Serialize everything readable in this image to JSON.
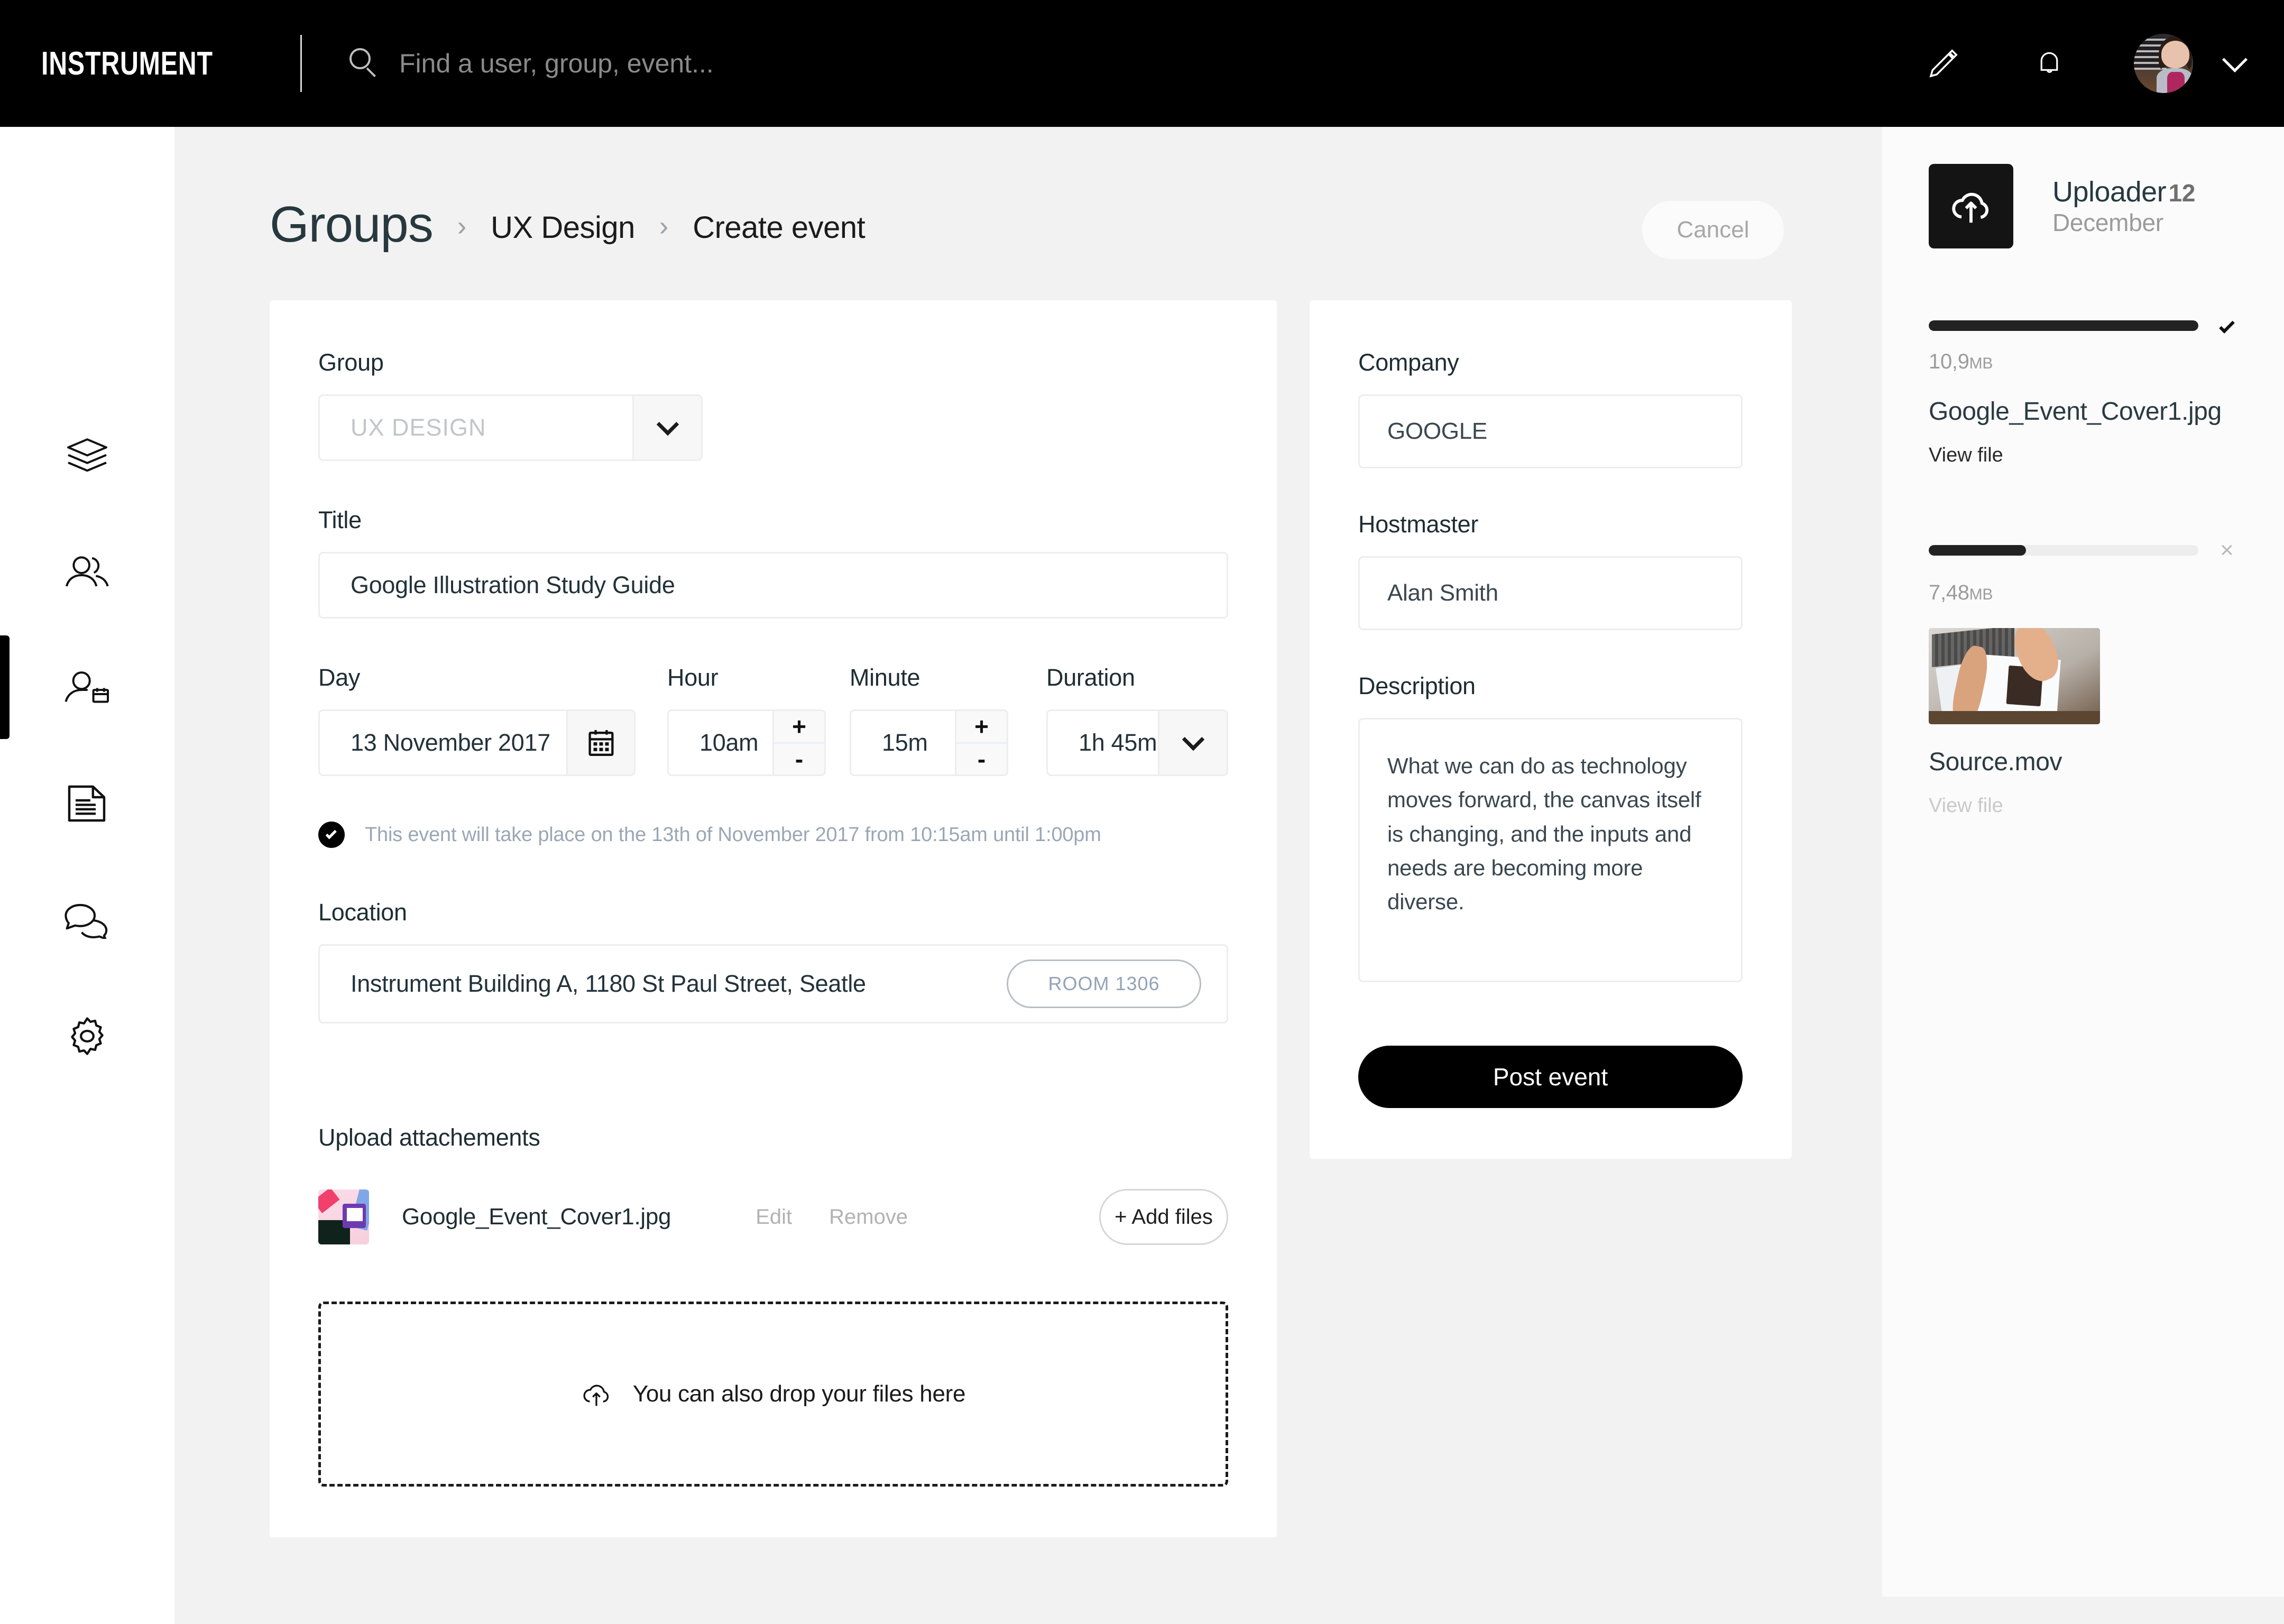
{
  "header": {
    "brand": "INSTRUMENT",
    "search_placeholder": "Find a user, group, event...",
    "icons": {
      "edit": "pencil-icon",
      "notifications": "bell-icon",
      "account": "avatar",
      "chevron": "chevron-down-icon"
    }
  },
  "sidebar": {
    "items": [
      {
        "name": "layers-icon",
        "active": false
      },
      {
        "name": "users-icon",
        "active": false
      },
      {
        "name": "user-calendar-icon",
        "active": true
      },
      {
        "name": "document-icon",
        "active": false
      },
      {
        "name": "chat-icon",
        "active": false
      },
      {
        "name": "settings-gear-icon",
        "active": false
      }
    ]
  },
  "breadcrumb": {
    "root": "Groups",
    "separator": "›",
    "level2": "UX Design",
    "level3": "Create event"
  },
  "actions": {
    "cancel": "Cancel"
  },
  "form": {
    "group": {
      "label": "Group",
      "value": "UX DESIGN"
    },
    "title": {
      "label": "Title",
      "value": "Google Illustration Study Guide"
    },
    "day": {
      "label": "Day",
      "value": "13 November 2017"
    },
    "hour": {
      "label": "Hour",
      "value": "10am",
      "increment": "+",
      "decrement": "-"
    },
    "minute": {
      "label": "Minute",
      "value": "15m",
      "increment": "+",
      "decrement": "-"
    },
    "duration": {
      "label": "Duration",
      "value": "1h 45m"
    },
    "confirmation": "This event will take place on the 13th of November 2017 from 10:15am until 1:00pm",
    "location": {
      "label": "Location",
      "value": "Instrument Building A, 1180 St Paul Street, Seatle",
      "room": "ROOM 1306"
    },
    "upload": {
      "label": "Upload attachements",
      "attachment_name": "Google_Event_Cover1.jpg",
      "edit": "Edit",
      "remove": "Remove",
      "add_files": "+ Add files",
      "dropzone": "You can also drop your files here"
    }
  },
  "details": {
    "company": {
      "label": "Company",
      "value": "GOOGLE"
    },
    "hostmaster": {
      "label": "Hostmaster",
      "value": "Alan Smith"
    },
    "description": {
      "label": "Description",
      "value": "What we can do as technology moves forward, the canvas itself is changing, and the inputs and needs are becoming more diverse."
    },
    "post_button": "Post event"
  },
  "uploader": {
    "title": "Uploader",
    "date_day": "12",
    "date_month": "December",
    "items": [
      {
        "progress": 100,
        "size_number": "10,9",
        "size_unit": "MB",
        "filename": "Google_Event_Cover1.jpg",
        "view": "View file",
        "status": "complete"
      },
      {
        "progress": 36,
        "size_number": "7,48",
        "size_unit": "MB",
        "filename": "Source.mov",
        "view": "View file",
        "status": "uploading",
        "cancel": "×"
      }
    ]
  },
  "colors": {
    "topbar_bg": "#000000",
    "page_bg": "#f2f2f2",
    "card_bg": "#ffffff",
    "accent_dark": "#111111",
    "heading": "#27383e",
    "muted": "#9aa7b5",
    "border": "#ededed",
    "uploader_bg": "#fbfbfb"
  }
}
